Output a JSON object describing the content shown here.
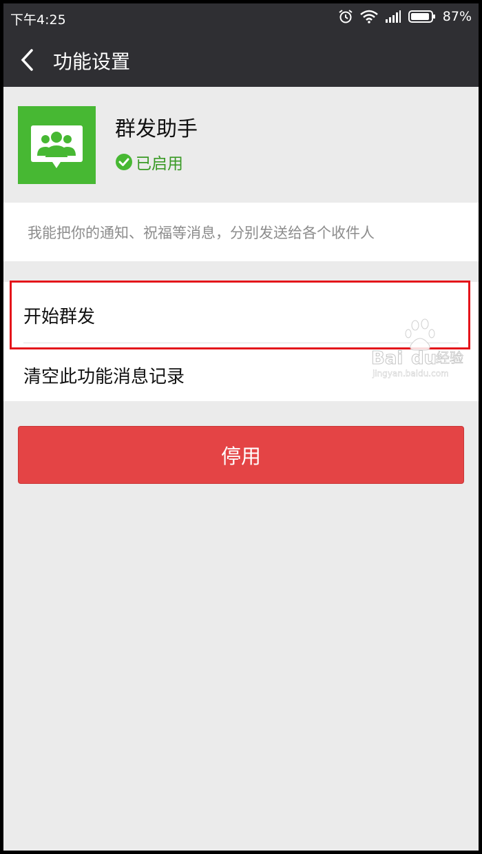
{
  "status_bar": {
    "time": "下午4:25",
    "battery": "87%"
  },
  "title_bar": {
    "title": "功能设置"
  },
  "plugin": {
    "name": "群发助手",
    "status": "已启用",
    "description": "我能把你的通知、祝福等消息，分别发送给各个收件人",
    "icon": "group-chat-icon",
    "icon_color": "#47b833"
  },
  "list": {
    "start_label": "开始群发",
    "clear_label": "清空此功能消息记录"
  },
  "disable_button": {
    "label": "停用",
    "color": "#e44445"
  },
  "watermark": {
    "brand_left": "Bai",
    "brand_right": "du",
    "suffix": "经验",
    "url": "jingyan.baidu.com"
  }
}
